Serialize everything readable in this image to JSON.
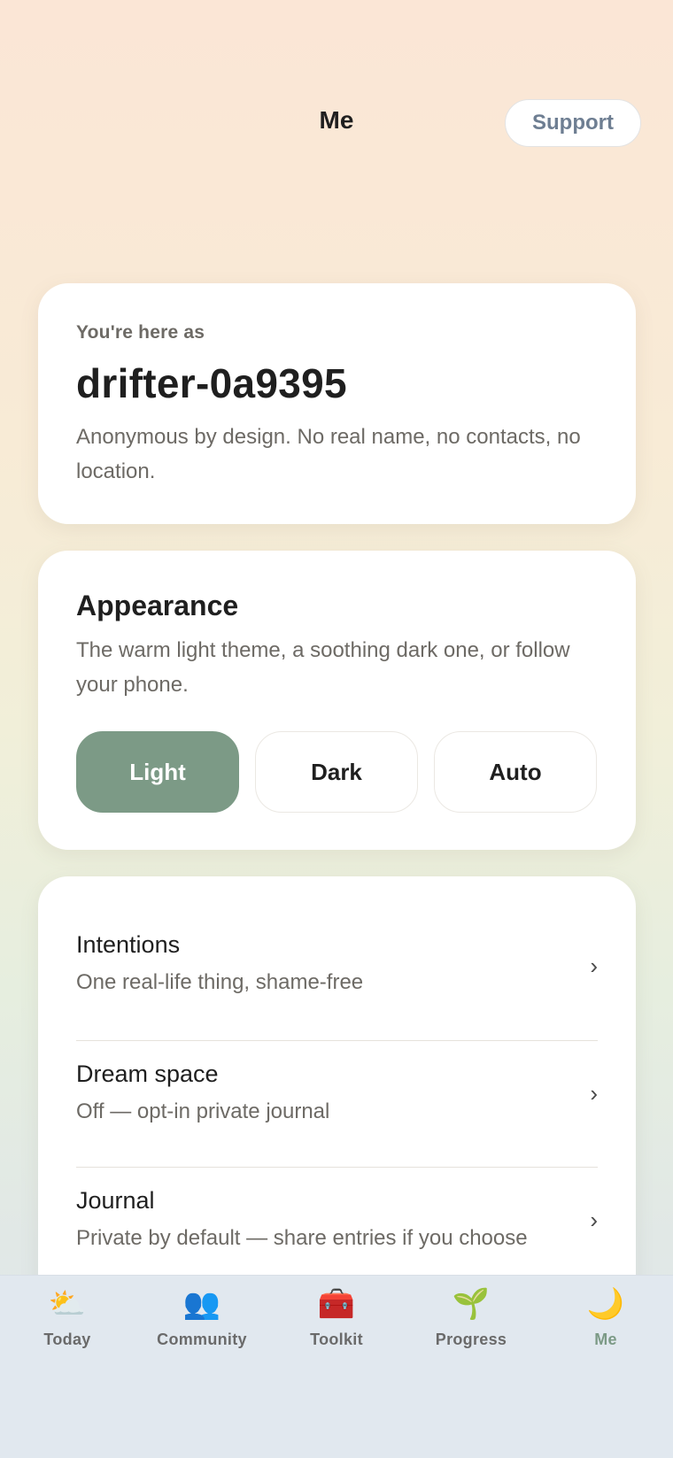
{
  "header": {
    "title": "Me",
    "support_label": "Support"
  },
  "identity": {
    "eyebrow": "You're here as",
    "handle": "drifter-0a9395",
    "description": "Anonymous by design. No real name, no contacts, no location."
  },
  "appearance": {
    "title": "Appearance",
    "description": "The warm light theme, a soothing dark one, or follow your phone.",
    "options": [
      "Light",
      "Dark",
      "Auto"
    ],
    "selected": "Light",
    "accent_color": "#7c9a86"
  },
  "list": {
    "items": [
      {
        "title": "Intentions",
        "subtitle": "One real-life thing, shame-free"
      },
      {
        "title": "Dream space",
        "subtitle": "Off — opt-in private journal"
      },
      {
        "title": "Journal",
        "subtitle": "Private by default — share entries if you choose"
      }
    ]
  },
  "tabbar": {
    "tabs": [
      {
        "label": "Today",
        "icon": "sun-behind-cloud-icon",
        "glyph": "⛅"
      },
      {
        "label": "Community",
        "icon": "people-icon",
        "glyph": "👥"
      },
      {
        "label": "Toolkit",
        "icon": "toolbox-icon",
        "glyph": "🧰"
      },
      {
        "label": "Progress",
        "icon": "seedling-icon",
        "glyph": "🌱"
      },
      {
        "label": "Me",
        "icon": "crescent-moon-icon",
        "glyph": "🌙"
      }
    ],
    "active": "Me"
  }
}
